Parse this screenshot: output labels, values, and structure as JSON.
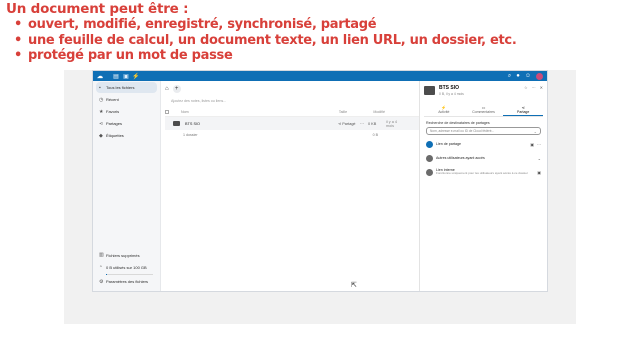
{
  "slide": {
    "title": "Un document peut être :",
    "bullets": [
      "ouvert, modifié, enregistré, synchronisé, partagé",
      "une feuille de calcul, un document texte, un lien URL, un dossier, etc.",
      "protégé par un mot de passe"
    ]
  },
  "sidebar": {
    "items": [
      {
        "label": "Tous les fichiers",
        "icon": "folder-icon"
      },
      {
        "label": "Récent",
        "icon": "clock-icon"
      },
      {
        "label": "Favoris",
        "icon": "star-icon"
      },
      {
        "label": "Partages",
        "icon": "share-icon"
      },
      {
        "label": "Étiquettes",
        "icon": "tag-icon"
      }
    ],
    "bottom": {
      "deleted": "Fichiers supprimés",
      "quota": "0 B utilisés sur 100 GB",
      "quota_fraction": 0.02,
      "settings": "Paramètres des fichiers"
    }
  },
  "files": {
    "search_hint": "Ajoutez des notes, listes ou liens...",
    "columns": {
      "name": "Nom",
      "size": "Taille",
      "modified": "Modifié"
    },
    "rows": [
      {
        "name": "BTS SIO",
        "share": "Partagé",
        "size": "0 KB",
        "modified": "il y a 4 mois"
      }
    ],
    "summary": {
      "count": "1 dossier",
      "size": "0 B"
    }
  },
  "panel": {
    "title": "BTS SIO",
    "subtitle": "0 B, il y a 4 mois",
    "tabs": [
      {
        "label": "Activité",
        "icon": "lightning-icon"
      },
      {
        "label": "Commentaires",
        "icon": "comment-icon"
      },
      {
        "label": "Partage",
        "icon": "share-icon"
      }
    ],
    "search_label": "Recherche de destinataires de partages",
    "search_placeholder": "Nom, adresse e-mail ou ID de Cloud fédéré...",
    "share_link": "Lien de partage",
    "others_access": "Autres utilisateurs ayant accès",
    "internal_link": "Lien interne",
    "internal_link_desc": "Fonctionne uniquement pour les utilisateurs ayant accès à ce dossier"
  },
  "colors": {
    "heading_red": "#d8403a",
    "brand_blue": "#0f6fb5"
  }
}
